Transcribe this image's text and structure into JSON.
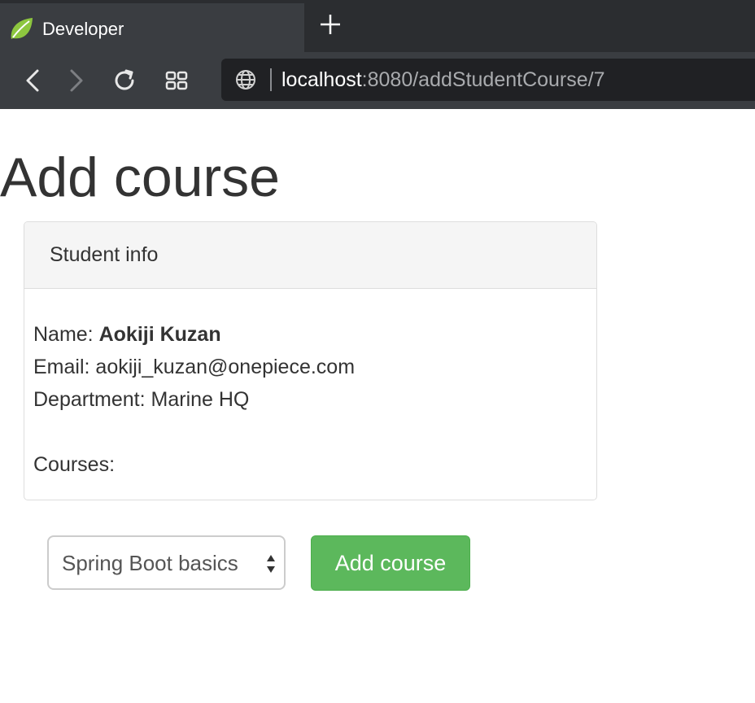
{
  "browser": {
    "tab_title": "Developer",
    "url_host": "localhost",
    "url_rest": ":8080/addStudentCourse/7",
    "icons": [
      "spring-leaf-icon",
      "plus-icon",
      "back-icon",
      "forward-icon",
      "reload-icon",
      "grid-icon",
      "globe-icon"
    ]
  },
  "page": {
    "title": "Add course",
    "panel": {
      "heading": "Student info",
      "name_label": "Name:",
      "name_value": "Aokiji Kuzan",
      "email_label": "Email:",
      "email_value": "aokiji_kuzan@onepiece.com",
      "department_label": "Department:",
      "department_value": "Marine HQ",
      "courses_label": "Courses:"
    },
    "form": {
      "selected_course": "Spring Boot basics",
      "submit_label": "Add course"
    }
  },
  "colors": {
    "accent_green": "#5cb85c",
    "chrome_dark": "#3a3d41",
    "text": "#333333"
  }
}
